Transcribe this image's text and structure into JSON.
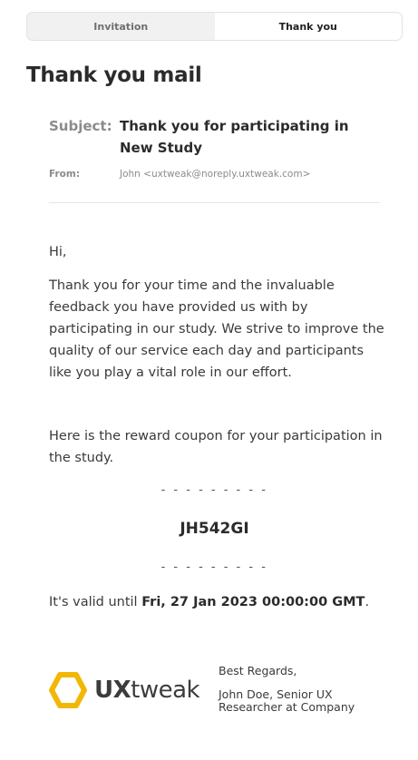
{
  "tabs": [
    {
      "label": "Invitation",
      "active": false
    },
    {
      "label": "Thank you",
      "active": true
    }
  ],
  "title": "Thank you mail",
  "subject": {
    "label": "Subject:",
    "value": "Thank you for participating in New Study"
  },
  "from": {
    "label": "From:",
    "value": "John <uxtweak@noreply.uxtweak.com>"
  },
  "body": {
    "greeting": "Hi,",
    "paragraph1": "Thank you for your time and the invaluable feedback you have provided us with by participating in our study. We strive to improve the quality of our service each day and participants like you play a vital role in our effort.",
    "paragraph2": "Here is the reward coupon for your participation in the study."
  },
  "coupon": {
    "dashes": "- - - - - - - - -",
    "code": "JH542GI"
  },
  "validity": {
    "prefix": "It's valid until ",
    "date": "Fri, 27 Jan 2023 00:00:00 GMT",
    "suffix": "."
  },
  "logo": {
    "ux": "UX",
    "tweak": "tweak",
    "accent_color": "#f2b705",
    "icon": "hexagon-logo-icon"
  },
  "signature": {
    "regards": "Best Regards,",
    "name": "John Doe, Senior UX Researcher at Company"
  }
}
